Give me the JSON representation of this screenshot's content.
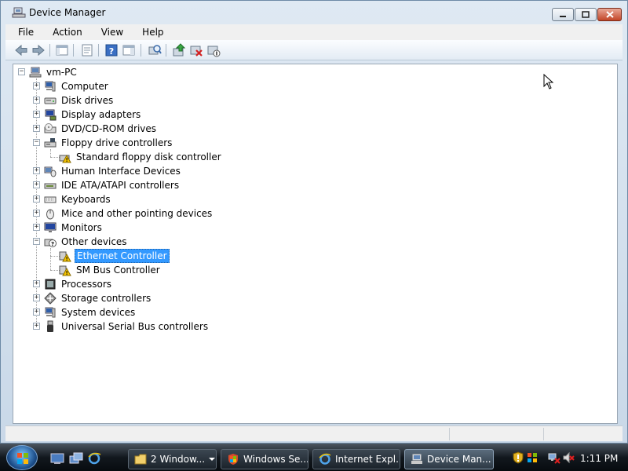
{
  "window": {
    "title": "Device Manager",
    "icon": "device-manager-icon"
  },
  "menu": {
    "items": [
      "File",
      "Action",
      "View",
      "Help"
    ]
  },
  "toolbar": {
    "icons": [
      "back-arrow-icon",
      "forward-arrow-icon",
      "show-hide-console-tree-icon",
      "properties-icon",
      "help-icon",
      "action-pane-icon",
      "scan-hardware-icon",
      "update-driver-icon",
      "uninstall-icon",
      "disable-device-icon"
    ]
  },
  "tree": {
    "root": "vm-PC",
    "items": [
      {
        "label": "Computer",
        "icon": "computer-icon"
      },
      {
        "label": "Disk drives",
        "icon": "disk-drive-icon"
      },
      {
        "label": "Display adapters",
        "icon": "display-adapter-icon"
      },
      {
        "label": "DVD/CD-ROM drives",
        "icon": "dvd-drive-icon"
      },
      {
        "label": "Floppy drive controllers",
        "icon": "floppy-controller-icon",
        "expanded": true,
        "children": [
          {
            "label": "Standard floppy disk controller",
            "icon": "warning-device-icon"
          }
        ]
      },
      {
        "label": "Human Interface Devices",
        "icon": "hid-icon"
      },
      {
        "label": "IDE ATA/ATAPI controllers",
        "icon": "ide-controller-icon"
      },
      {
        "label": "Keyboards",
        "icon": "keyboard-icon"
      },
      {
        "label": "Mice and other pointing devices",
        "icon": "mouse-icon"
      },
      {
        "label": "Monitors",
        "icon": "monitor-icon"
      },
      {
        "label": "Other devices",
        "icon": "unknown-device-icon",
        "expanded": true,
        "children": [
          {
            "label": "Ethernet Controller",
            "icon": "warning-device-icon",
            "selected": true
          },
          {
            "label": "SM Bus Controller",
            "icon": "warning-device-icon"
          }
        ]
      },
      {
        "label": "Processors",
        "icon": "processor-icon"
      },
      {
        "label": "Storage controllers",
        "icon": "storage-controller-icon"
      },
      {
        "label": "System devices",
        "icon": "system-devices-icon"
      },
      {
        "label": "Universal Serial Bus controllers",
        "icon": "usb-icon"
      }
    ]
  },
  "taskbar": {
    "buttons": [
      {
        "label": "2 Window...",
        "icon": "folder-icon"
      },
      {
        "label": "Windows Se...",
        "icon": "windows-security-icon"
      },
      {
        "label": "Internet Expl...",
        "icon": "internet-explorer-icon"
      },
      {
        "label": "Device Man...",
        "icon": "device-manager-icon",
        "active": true
      }
    ],
    "clock": "1:11 PM"
  },
  "colors": {
    "selection": "#3399ff",
    "warning": "#f5c400"
  }
}
